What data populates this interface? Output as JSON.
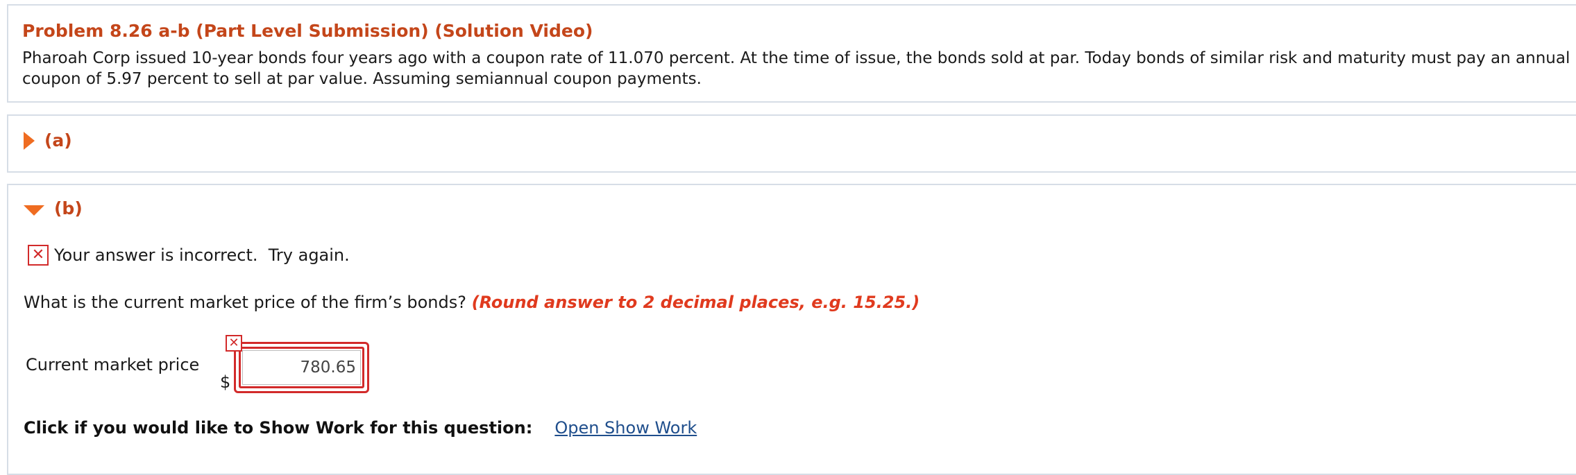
{
  "problem": {
    "title": "Problem 8.26 a-b (Part Level Submission) (Solution Video)",
    "text": "Pharoah Corp issued 10-year bonds four years ago with a coupon rate of 11.070 percent. At the time of issue, the bonds sold at par. Today bonds of similar risk and maturity must pay an annual coupon of 5.97 percent to sell at par value. Assuming semiannual coupon payments."
  },
  "part_a": {
    "label": "(a)",
    "expanded": false
  },
  "part_b": {
    "label": "(b)",
    "expanded": true,
    "feedback": "Your answer is incorrect.  Try again.",
    "question": "What is the current market price of the firm’s bonds?",
    "hint": "(Round answer to 2 decimal places, e.g. 15.25.)",
    "field_label": "Current market price",
    "currency_symbol": "$",
    "answer_value": "780.65",
    "answer_status": "incorrect",
    "show_work_label": "Click if you would like to Show Work for this question:",
    "show_work_link": "Open Show Work"
  },
  "icons": {
    "collapsed": "caret-right-icon",
    "expanded": "caret-down-icon",
    "incorrect": "x-mark-icon"
  },
  "colors": {
    "accent_orange": "#ef6c21",
    "title_orange": "#c4461a",
    "error_red": "#d22a2a",
    "hint_red": "#e03a1e",
    "link_blue": "#1f4e8c",
    "panel_border": "#d6dde6"
  }
}
